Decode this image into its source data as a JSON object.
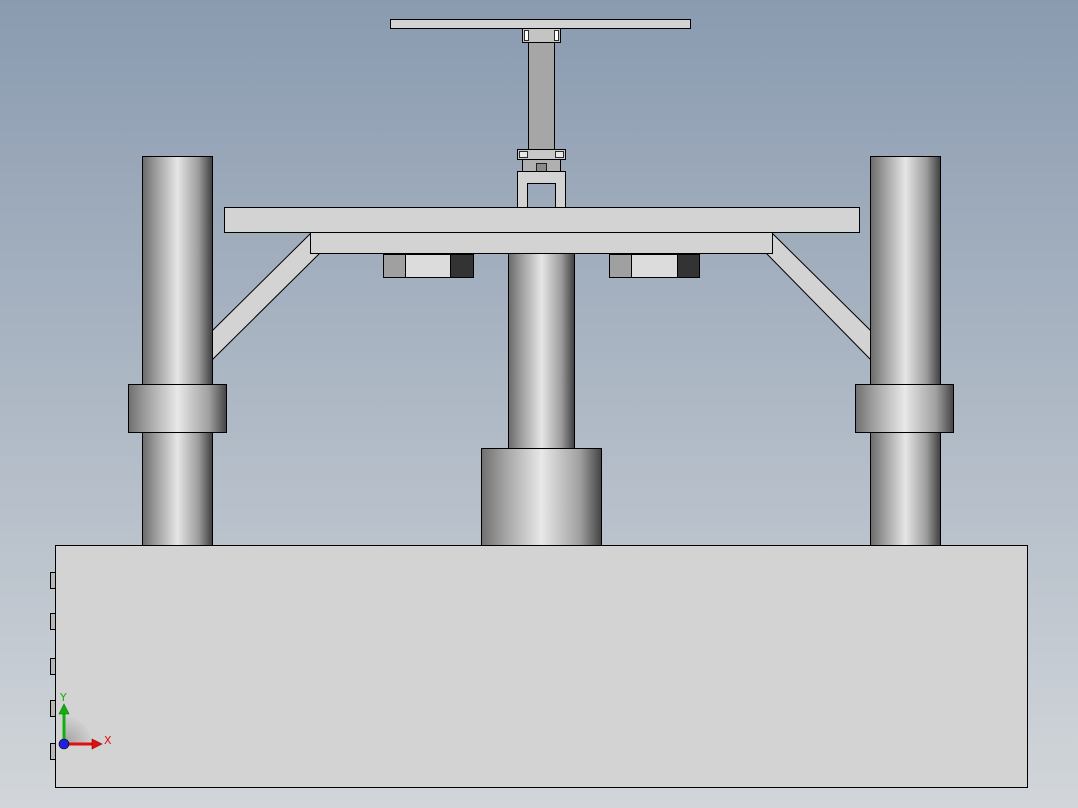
{
  "viewport": {
    "background_top": "#8a9bb0",
    "background_bottom": "#d2d6da"
  },
  "model": {
    "part_fill": "#d3d3d3",
    "edge_color": "#000000",
    "dark_block": "#333333",
    "mid_block": "#a0a0a0"
  },
  "triad": {
    "x_label": "X",
    "y_label": "Y",
    "x_color": "#e01010",
    "y_color": "#10b010",
    "z_color": "#2020e0"
  }
}
